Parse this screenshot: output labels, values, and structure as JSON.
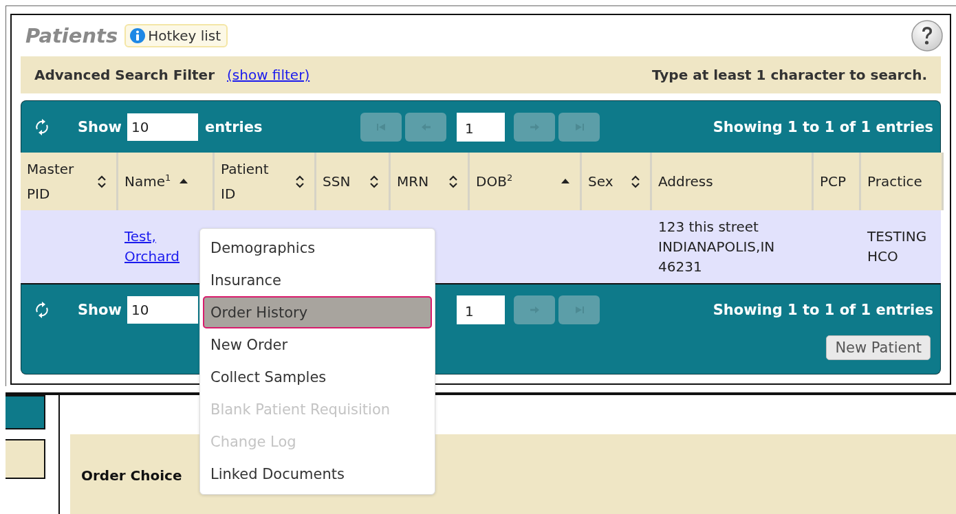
{
  "header": {
    "title": "Patients",
    "hotkey_button": "Hotkey list"
  },
  "filter_bar": {
    "label": "Advanced Search Filter",
    "link": "(show filter)",
    "hint": "Type at least 1 character to search."
  },
  "top_toolbar": {
    "show_label": "Show",
    "page_size": "10",
    "entries_label": "entries",
    "pager_before": [
      {
        "kind": "first",
        "disabled": true
      },
      {
        "kind": "prev",
        "disabled": true
      }
    ],
    "page": "1",
    "pager_after": [
      {
        "kind": "next",
        "disabled": true
      },
      {
        "kind": "last",
        "disabled": true
      }
    ],
    "info": "Showing 1 to 1 of 1 entries"
  },
  "table": {
    "columns": [
      {
        "label": "Master PID",
        "kind": "sortable"
      },
      {
        "label": "Name$^{1}$",
        "kind": "sorted"
      },
      {
        "label": "Patient ID",
        "kind": "sortable"
      },
      {
        "label": "SSN",
        "kind": "sortable"
      },
      {
        "label": "MRN",
        "kind": "sortable"
      },
      {
        "label": "DOB$^{2}$",
        "kind": "sorted"
      },
      {
        "label": "Sex",
        "kind": "sortable"
      },
      {
        "label": "Address",
        "kind": "plain"
      },
      {
        "label": "PCP",
        "kind": "plain"
      },
      {
        "label": "Practice",
        "kind": "plain"
      }
    ],
    "rows": [
      {
        "cells": [
          "",
          {
            "kind": "link",
            "text": "Test, Orchard"
          },
          "",
          "",
          "",
          "",
          "",
          "123 this street INDIANAPOLIS,IN 46231",
          "",
          "TESTING HCO"
        ]
      }
    ]
  },
  "bottom_toolbar": {
    "show_label": "Show",
    "page_size": "10",
    "page": "1",
    "pager_after": [
      {
        "kind": "next",
        "disabled": true
      },
      {
        "kind": "last",
        "disabled": true
      }
    ],
    "info": "Showing 1 to 1 of 1 entries",
    "new_button": "New Patient"
  },
  "context_menu": {
    "items": [
      {
        "label": "Demographics",
        "disabled": false,
        "selected": false
      },
      {
        "label": "Insurance",
        "disabled": false,
        "selected": false
      },
      {
        "label": "Order History",
        "disabled": false,
        "selected": true
      },
      {
        "label": "New Order",
        "disabled": false,
        "selected": false
      },
      {
        "label": "Collect Samples",
        "disabled": false,
        "selected": false
      },
      {
        "label": "Blank Patient Requisition",
        "disabled": true,
        "selected": false
      },
      {
        "label": "Change Log",
        "disabled": true,
        "selected": false
      },
      {
        "label": "Linked Documents",
        "disabled": false,
        "selected": false
      }
    ]
  },
  "lower_section": {
    "label": "Order Choice"
  }
}
